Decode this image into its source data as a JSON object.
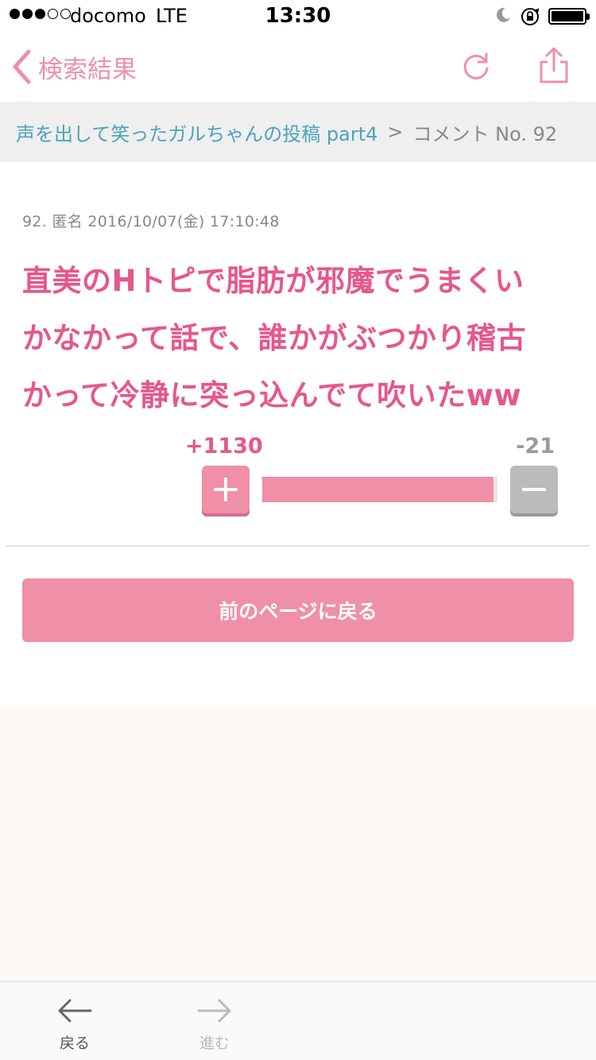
{
  "status_bar": {
    "carrier": "docomo",
    "network": "LTE",
    "time": "13:30",
    "signal_full": 3,
    "signal_total": 5,
    "icons": [
      "moon-icon",
      "rotation-lock-icon",
      "battery-icon"
    ]
  },
  "nav": {
    "back_label": "検索結果",
    "icons": [
      "chevron-left-icon",
      "reload-icon",
      "share-icon"
    ],
    "accent_color": "#ef8fa8"
  },
  "breadcrumb": {
    "topic": "声を出して笑ったガルちゃんの投稿 part4",
    "separator": ">",
    "current": "コメント No. 92"
  },
  "comment": {
    "meta": "92. 匿名 2016/10/07(金) 17:10:48",
    "lines": [
      "直美のHトピで脂肪が邪魔でうまくい",
      "かなかって話で、誰かがぶつかり稽古",
      "かって冷静に突っ込んでて吹いたww"
    ],
    "text_color": "#e6578a"
  },
  "votes": {
    "plus": "+1130",
    "minus": "-21",
    "plus_value": 1130,
    "minus_value": 21,
    "plus_color": "#ef8fa8",
    "minus_color": "#bbbbbb"
  },
  "back_page_button": "前のページに戻る",
  "toolbar": {
    "back_label": "戻る",
    "forward_label": "進む",
    "icons": [
      "arrow-left-icon",
      "arrow-right-icon"
    ]
  }
}
